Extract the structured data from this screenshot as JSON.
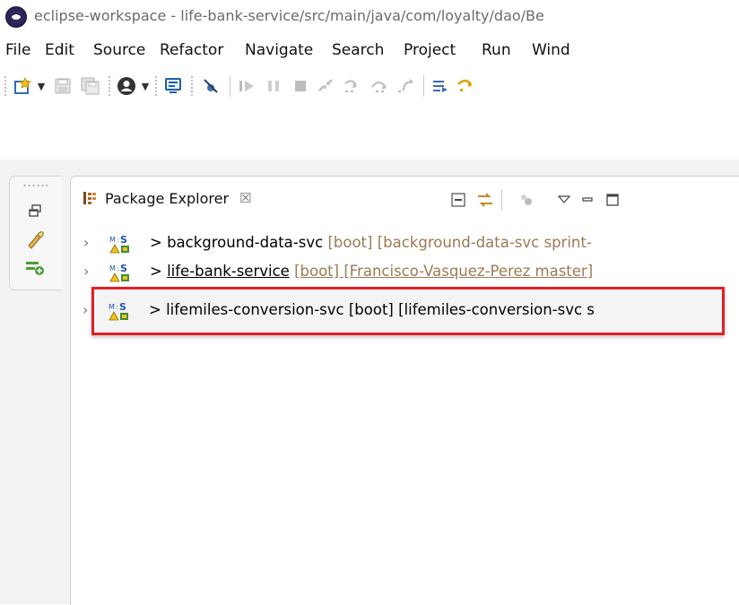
{
  "window": {
    "title": "eclipse-workspace - life-bank-service/src/main/java/com/loyalty/dao/Be",
    "app_icon": "eclipse-icon"
  },
  "menu": {
    "items": [
      "File",
      "Edit",
      "Source",
      "Refactor",
      "Navigate",
      "Search",
      "Project",
      "Run",
      "Wind"
    ]
  },
  "toolbar": {
    "icons": [
      "new-wizard-icon",
      "save-icon",
      "save-all-icon",
      "user-avatar-icon",
      "console-icon",
      "skip-breakpoints-icon",
      "resume-icon",
      "suspend-icon",
      "terminate-icon",
      "disconnect-icon",
      "step-into-icon",
      "step-over-icon",
      "step-return-icon",
      "drop-to-frame-icon",
      "use-step-filters-icon"
    ]
  },
  "side_trim": {
    "icons": [
      "restore-icon",
      "debug-perspective-icon",
      "new-perspective-icon"
    ]
  },
  "package_explorer": {
    "tab_label": "Package Explorer",
    "close_symbol": "☒",
    "tab_icon": "package-explorer-icon",
    "toolbar_icons": [
      "collapse-all-icon",
      "link-with-editor-icon",
      "focus-on-task-icon",
      "view-menu-icon",
      "minimize-icon",
      "maximize-icon"
    ],
    "projects": [
      {
        "prefix": ">",
        "name": "background-data-svc",
        "decoration": "[boot] [background-data-svc sprint-",
        "icon": "maven-spring-project-icon"
      },
      {
        "prefix": ">",
        "name": "life-bank-service",
        "decoration": "[boot] [Francisco-Vasquez-Perez master]",
        "icon": "maven-spring-project-icon"
      },
      {
        "prefix": ">",
        "name": "lifemiles-conversion-svc",
        "decoration": "[boot] [lifemiles-conversion-svc s",
        "icon": "maven-spring-project-icon",
        "highlighted": true
      }
    ]
  },
  "colors": {
    "highlight_border": "#e21f26",
    "decoration_text": "#9b7a52"
  }
}
